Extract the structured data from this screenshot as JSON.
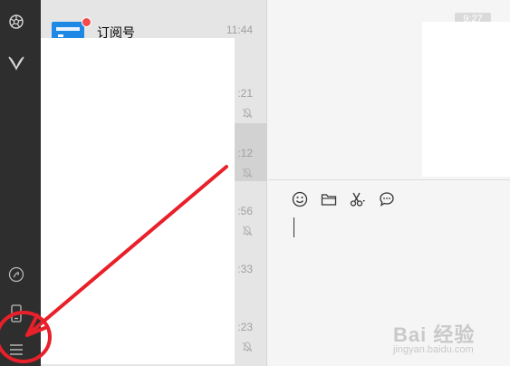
{
  "sidebar": {
    "icons": [
      "moments-icon",
      "mini-programs-icon",
      "link-icon",
      "phone-icon",
      "menu-icon"
    ]
  },
  "chat_list": {
    "rows": [
      {
        "name": "订阅号",
        "time": "11:44"
      },
      {
        "time": ":21"
      },
      {
        "time": ":12"
      },
      {
        "time": ":56"
      },
      {
        "time": ":33"
      },
      {
        "time": ":23"
      }
    ]
  },
  "main": {
    "timestamp": "9:27",
    "toolbar_icons": [
      "emoji-icon",
      "folder-icon",
      "screenshot-icon",
      "chat-history-icon"
    ]
  },
  "annotation": {
    "color": "#e8202a"
  },
  "watermark": {
    "text_cn": "Bai 经验",
    "text_url": "jingyan.baidu.com"
  }
}
